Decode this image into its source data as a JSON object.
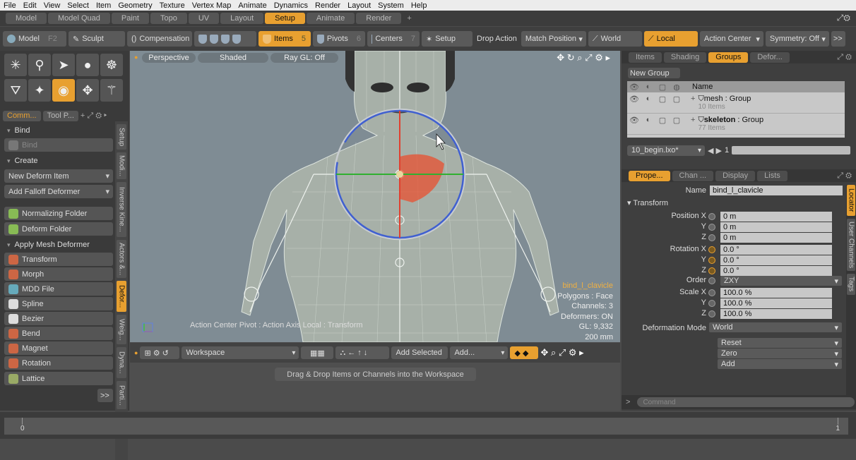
{
  "menubar": {
    "items": [
      "File",
      "Edit",
      "View",
      "Select",
      "Item",
      "Geometry",
      "Texture",
      "Vertex Map",
      "Animate",
      "Dynamics",
      "Render",
      "Layout",
      "System",
      "Help"
    ]
  },
  "layout_tabs": {
    "items": [
      "Model",
      "Model Quad",
      "Paint",
      "Topo",
      "UV",
      "Layout",
      "Setup",
      "Animate",
      "Render"
    ],
    "active": "Setup",
    "plus": "+"
  },
  "toolbar": {
    "model_label": "Model",
    "model_key": "F2",
    "sculpt_label": "Sculpt",
    "compensation_label": "Compensation",
    "items_label": "Items",
    "items_num": "5",
    "pivots_label": "Pivots",
    "pivots_num": "6",
    "centers_label": "Centers",
    "centers_num": "7",
    "setup_label": "Setup",
    "drop_action_label": "Drop Action",
    "match_position_label": "Match Position",
    "world_label": "World",
    "local_label": "Local",
    "action_center_label": "Action Center",
    "symmetry_label": "Symmetry: Off",
    "more_label": ">>"
  },
  "left_panel": {
    "tabs": [
      "Comm...",
      "Tool P..."
    ],
    "sections": {
      "bind": "Bind",
      "create": "Create",
      "apply_mesh_deformer": "Apply Mesh Deformer"
    },
    "bind_button": "Bind",
    "new_deform_item": "New Deform Item",
    "add_falloff_deformer": "Add Falloff Deformer",
    "normalizing_folder": "Normalizing Folder",
    "deform_folder": "Deform Folder",
    "deformers": [
      "Transform",
      "Morph",
      "MDD File",
      "Spline",
      "Bezier",
      "Bend",
      "Magnet",
      "Rotation",
      "Lattice"
    ],
    "more_label": ">>",
    "vertical_tabs": [
      "Setup",
      "Modi...",
      "Inverse Kine...",
      "Actors &...",
      "Defor...",
      "Weig...",
      "Dyna...",
      "Parti..."
    ]
  },
  "viewport": {
    "view_label": "Perspective",
    "shading_label": "Shaded",
    "raygl_label": "Ray GL: Off",
    "info": {
      "selected": "bind_l_clavicle",
      "polygons": "Polygons : Face",
      "channels": "Channels: 3",
      "deformers": "Deformers: ON",
      "gl": "GL: 9,332",
      "size": "200 mm"
    },
    "action_center_text": "Action Center Pivot : Action Axis Local : Transform"
  },
  "workspace": {
    "workspace_label": "Workspace",
    "add_selected_label": "Add Selected",
    "add_label": "Add...",
    "drop_hint": "Drag & Drop Items or Channels into the Workspace"
  },
  "right_panel": {
    "top_tabs": [
      "Items",
      "Shading",
      "Groups",
      "Defor..."
    ],
    "top_active": "Groups",
    "new_group_label": "New Group",
    "table_header": "Name",
    "groups": [
      {
        "name": "mesh",
        "type": " : Group",
        "count": "10 Items"
      },
      {
        "name": "skeleton",
        "type": " : Group",
        "count": "77 Items"
      }
    ],
    "scene_file": "10_begin.lxo*",
    "scene_frame": "1",
    "prop_tabs": [
      "Prope...",
      "Chan ...",
      "Display",
      "Lists"
    ],
    "prop_active": "Prope...",
    "name_label": "Name",
    "name_value": "bind_l_clavicle",
    "transform_section": "Transform",
    "position_label": "Position X",
    "position": [
      "0 m",
      "0 m",
      "0 m"
    ],
    "rotation_label": "Rotation X",
    "rotation": [
      "0.0 °",
      "0.0 °",
      "0.0 °"
    ],
    "order_label": "Order",
    "order_value": "ZXY",
    "scale_label": "Scale X",
    "scale": [
      "100.0 %",
      "100.0 %",
      "100.0 %"
    ],
    "axis_y": "Y",
    "axis_z": "Z",
    "deformation_mode_label": "Deformation Mode",
    "deformation_mode_value": "World",
    "reset_label": "Reset",
    "zero_label": "Zero",
    "add_label": "Add",
    "side_tabs": [
      "Locator",
      "User Channels",
      "Tags"
    ],
    "command_placeholder": "Command",
    "command_arrow": ">"
  },
  "timeline": {
    "start": "0",
    "end": "1"
  },
  "colors": {
    "accent": "#e8a030",
    "viewport_bg": "#7f8c94",
    "selected_text": "#f0b040"
  }
}
